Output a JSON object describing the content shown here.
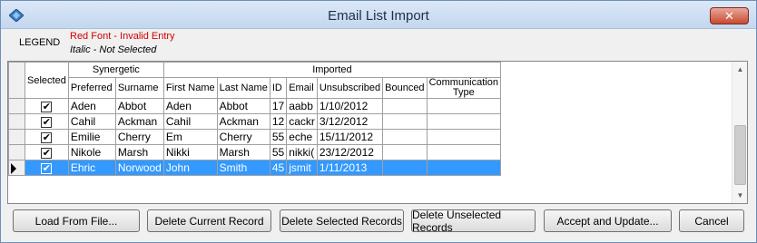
{
  "window": {
    "title": "Email List Import",
    "close_label": "✕"
  },
  "legend": {
    "label": "LEGEND",
    "red_text": "Red Font - Invalid Entry",
    "italic_text": "Italic - Not Selected",
    "red_color": "#d40000"
  },
  "grid": {
    "groups": {
      "selected": "Selected",
      "synergetic": "Synergetic",
      "imported": "Imported"
    },
    "columns": {
      "preferred": "Preferred",
      "surname": "Surname",
      "first_name": "First Name",
      "last_name": "Last Name",
      "id": "ID",
      "email": "Email",
      "unsubscribed": "Unsubscribed",
      "bounced": "Bounced",
      "communication_type": "Communication Type"
    },
    "rows": [
      {
        "selected": true,
        "preferred": "Aden",
        "surname": "Abbot",
        "first_name": "Aden",
        "last_name": "Abbot",
        "id": "17",
        "email": "aabb",
        "unsubscribed": "1/10/2012",
        "bounced": "",
        "communication_type": ""
      },
      {
        "selected": true,
        "preferred": "Cahil",
        "surname": "Ackman",
        "first_name": "Cahil",
        "last_name": "Ackman",
        "id": "12",
        "email": "cackr",
        "unsubscribed": "3/12/2012",
        "bounced": "",
        "communication_type": ""
      },
      {
        "selected": true,
        "preferred": "Emilie",
        "surname": "Cherry",
        "first_name": "Em",
        "last_name": "Cherry",
        "id": "55",
        "email": "eche",
        "unsubscribed": "15/11/2012",
        "bounced": "",
        "communication_type": ""
      },
      {
        "selected": true,
        "preferred": "Nikole",
        "surname": "Marsh",
        "first_name": "Nikki",
        "last_name": "Marsh",
        "id": "55",
        "email": "nikki(",
        "unsubscribed": "23/12/2012",
        "bounced": "",
        "communication_type": ""
      },
      {
        "selected": true,
        "preferred": "Ehric",
        "surname": "Norwood",
        "first_name": "John",
        "last_name": "Smith",
        "id": "45",
        "email": "jsmit",
        "unsubscribed": "1/11/2013",
        "bounced": "",
        "communication_type": "",
        "current": true
      }
    ],
    "selection_color": "#3399ff"
  },
  "buttons": {
    "load": "Load From File...",
    "delete_current": "Delete Current Record",
    "delete_selected": "Delete Selected Records",
    "delete_unselected": "Delete Unselected Records",
    "accept": "Accept and Update...",
    "cancel": "Cancel"
  },
  "icons": {
    "app": "diamond-app-icon",
    "close": "close-icon",
    "check": "check-icon",
    "row_pointer": "row-pointer-icon",
    "scroll_up": "scroll-up-icon",
    "scroll_down": "scroll-down-icon"
  }
}
